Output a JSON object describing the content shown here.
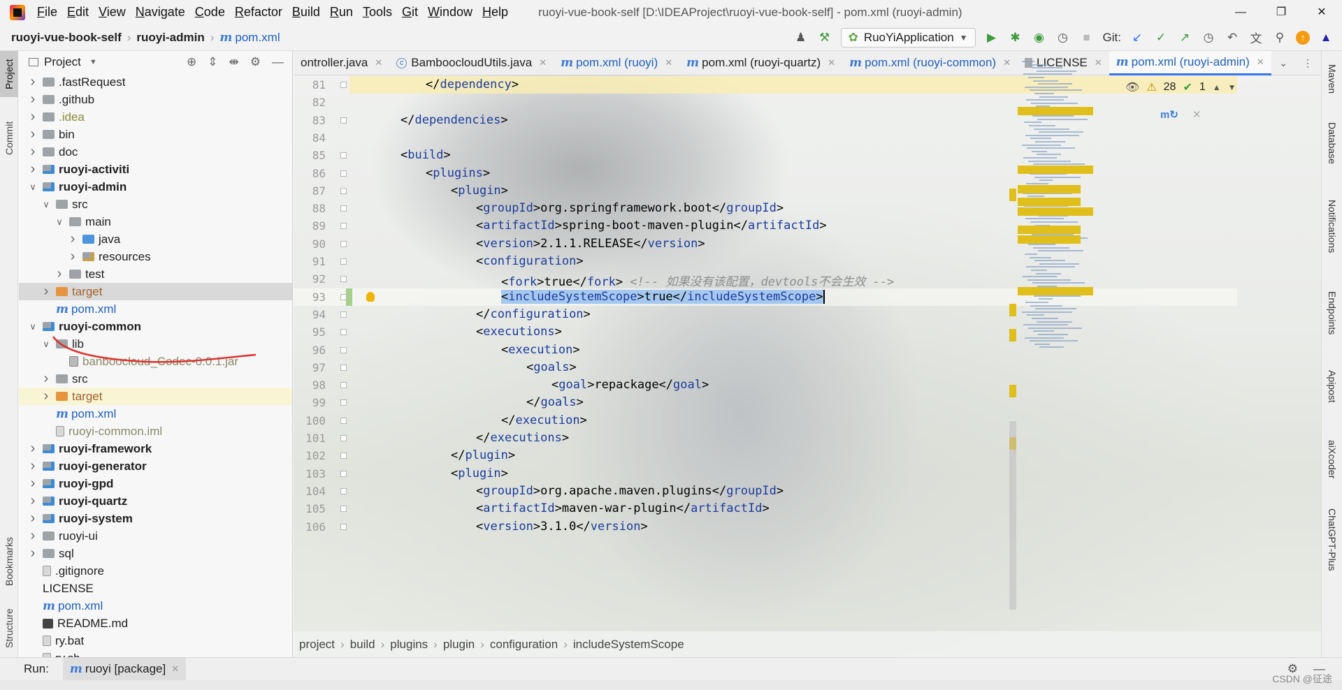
{
  "titlebar": {
    "menu": [
      "File",
      "Edit",
      "View",
      "Navigate",
      "Code",
      "Refactor",
      "Build",
      "Run",
      "Tools",
      "Git",
      "Window",
      "Help"
    ],
    "title": "ruoyi-vue-book-self [D:\\IDEAProject\\ruoyi-vue-book-self] - pom.xml (ruoyi-admin)"
  },
  "navbar": {
    "project": "ruoyi-vue-book-self",
    "module": "ruoyi-admin",
    "file": "pom.xml",
    "run_config": "RuoYiApplication",
    "git_label": "Git:"
  },
  "left_strip": {
    "tabs": [
      "Project",
      "Commit",
      "Bookmarks",
      "Structure"
    ]
  },
  "right_strip": {
    "tabs": [
      "Maven",
      "Database",
      "Notifications",
      "Endpoints",
      "Apipost",
      "aiXcoder",
      "ChatGPT-Plus"
    ]
  },
  "project_panel": {
    "title": "Project",
    "tree": [
      {
        "label": ".fastRequest",
        "depth": 1,
        "chev": "right",
        "icon": "folder",
        "style": ""
      },
      {
        "label": ".github",
        "depth": 1,
        "chev": "right",
        "icon": "folder",
        "style": ""
      },
      {
        "label": ".idea",
        "depth": 1,
        "chev": "right",
        "icon": "folder",
        "style": "muted"
      },
      {
        "label": "bin",
        "depth": 1,
        "chev": "right",
        "icon": "folder",
        "style": ""
      },
      {
        "label": "doc",
        "depth": 1,
        "chev": "right",
        "icon": "folder",
        "style": ""
      },
      {
        "label": "ruoyi-activiti",
        "depth": 1,
        "chev": "right",
        "icon": "module",
        "style": "bold"
      },
      {
        "label": "ruoyi-admin",
        "depth": 1,
        "chev": "down",
        "icon": "module",
        "style": "bold"
      },
      {
        "label": "src",
        "depth": 2,
        "chev": "down",
        "icon": "folder",
        "style": ""
      },
      {
        "label": "main",
        "depth": 3,
        "chev": "down",
        "icon": "folder",
        "style": ""
      },
      {
        "label": "java",
        "depth": 4,
        "chev": "right",
        "icon": "blue",
        "style": ""
      },
      {
        "label": "resources",
        "depth": 4,
        "chev": "right",
        "icon": "res",
        "style": ""
      },
      {
        "label": "test",
        "depth": 3,
        "chev": "right",
        "icon": "folder",
        "style": ""
      },
      {
        "label": "target",
        "depth": 2,
        "chev": "right",
        "icon": "orange",
        "style": "orange",
        "row": "sel"
      },
      {
        "label": "pom.xml",
        "depth": 2,
        "chev": "none",
        "icon": "m",
        "style": "link"
      },
      {
        "label": "ruoyi-common",
        "depth": 1,
        "chev": "down",
        "icon": "module",
        "style": "bold"
      },
      {
        "label": "lib",
        "depth": 2,
        "chev": "down",
        "icon": "folder",
        "style": ""
      },
      {
        "label": "banboocloud_Codec-0.0.1.jar",
        "depth": 3,
        "chev": "none",
        "icon": "jar",
        "style": "jar"
      },
      {
        "label": "src",
        "depth": 2,
        "chev": "right",
        "icon": "folder",
        "style": ""
      },
      {
        "label": "target",
        "depth": 2,
        "chev": "right",
        "icon": "orange",
        "style": "orange",
        "row": "hl"
      },
      {
        "label": "pom.xml",
        "depth": 2,
        "chev": "none",
        "icon": "m",
        "style": "link"
      },
      {
        "label": "ruoyi-common.iml",
        "depth": 2,
        "chev": "none",
        "icon": "file",
        "style": "jar"
      },
      {
        "label": "ruoyi-framework",
        "depth": 1,
        "chev": "right",
        "icon": "module",
        "style": "bold"
      },
      {
        "label": "ruoyi-generator",
        "depth": 1,
        "chev": "right",
        "icon": "module",
        "style": "bold"
      },
      {
        "label": "ruoyi-gpd",
        "depth": 1,
        "chev": "right",
        "icon": "module",
        "style": "bold"
      },
      {
        "label": "ruoyi-quartz",
        "depth": 1,
        "chev": "right",
        "icon": "module",
        "style": "bold"
      },
      {
        "label": "ruoyi-system",
        "depth": 1,
        "chev": "right",
        "icon": "module",
        "style": "bold"
      },
      {
        "label": "ruoyi-ui",
        "depth": 1,
        "chev": "right",
        "icon": "folder",
        "style": ""
      },
      {
        "label": "sql",
        "depth": 1,
        "chev": "right",
        "icon": "folder",
        "style": ""
      },
      {
        "label": ".gitignore",
        "depth": 1,
        "chev": "none",
        "icon": "file",
        "style": ""
      },
      {
        "label": "LICENSE",
        "depth": 1,
        "chev": "none",
        "icon": "none",
        "style": ""
      },
      {
        "label": "pom.xml",
        "depth": 1,
        "chev": "none",
        "icon": "m",
        "style": "link"
      },
      {
        "label": "README.md",
        "depth": 1,
        "chev": "none",
        "icon": "md",
        "style": ""
      },
      {
        "label": "ry.bat",
        "depth": 1,
        "chev": "none",
        "icon": "file",
        "style": ""
      },
      {
        "label": "ry.sh",
        "depth": 1,
        "chev": "none",
        "icon": "file",
        "style": ""
      }
    ]
  },
  "editor": {
    "tabs": [
      {
        "label": "ontroller.java",
        "kind": "plain",
        "active": false,
        "close": true
      },
      {
        "label": "BamboocloudUtils.java",
        "kind": "class",
        "active": false,
        "close": true
      },
      {
        "label": "pom.xml (ruoyi)",
        "kind": "pom",
        "active": false,
        "close": true
      },
      {
        "label": "pom.xml (ruoyi-quartz)",
        "kind": "pom-dark",
        "active": false,
        "close": true
      },
      {
        "label": "pom.xml (ruoyi-common)",
        "kind": "pom",
        "active": false,
        "close": true
      },
      {
        "label": "LICENSE",
        "kind": "license",
        "active": false,
        "close": true
      },
      {
        "label": "pom.xml (ruoyi-admin)",
        "kind": "pom",
        "active": true,
        "close": true
      }
    ],
    "inspections": {
      "warnings": "28",
      "ok": "1"
    },
    "lines": [
      {
        "n": "81",
        "indent": 2,
        "parts": [
          [
            "br",
            "</"
          ],
          [
            "tag",
            "dependency"
          ],
          [
            "br",
            ">"
          ]
        ],
        "bg": "yellow"
      },
      {
        "n": "82",
        "indent": 0,
        "parts": []
      },
      {
        "n": "83",
        "indent": 1,
        "parts": [
          [
            "br",
            "</"
          ],
          [
            "tag",
            "dependencies"
          ],
          [
            "br",
            ">"
          ]
        ]
      },
      {
        "n": "84",
        "indent": 0,
        "parts": []
      },
      {
        "n": "85",
        "indent": 1,
        "parts": [
          [
            "br",
            "<"
          ],
          [
            "tag",
            "build"
          ],
          [
            "br",
            ">"
          ]
        ]
      },
      {
        "n": "86",
        "indent": 2,
        "parts": [
          [
            "br",
            "<"
          ],
          [
            "tag",
            "plugins"
          ],
          [
            "br",
            ">"
          ]
        ]
      },
      {
        "n": "87",
        "indent": 3,
        "parts": [
          [
            "br",
            "<"
          ],
          [
            "tag",
            "plugin"
          ],
          [
            "br",
            ">"
          ]
        ]
      },
      {
        "n": "88",
        "indent": 4,
        "parts": [
          [
            "br",
            "<"
          ],
          [
            "tag",
            "groupId"
          ],
          [
            "br",
            ">org.springframework.boot</"
          ],
          [
            "tag",
            "groupId"
          ],
          [
            "br",
            ">"
          ]
        ]
      },
      {
        "n": "89",
        "indent": 4,
        "parts": [
          [
            "br",
            "<"
          ],
          [
            "tag",
            "artifactId"
          ],
          [
            "br",
            ">spring-boot-maven-plugin</"
          ],
          [
            "tag",
            "artifactId"
          ],
          [
            "br",
            ">"
          ]
        ]
      },
      {
        "n": "90",
        "indent": 4,
        "parts": [
          [
            "br",
            "<"
          ],
          [
            "tag",
            "version"
          ],
          [
            "br",
            ">2.1.1.RELEASE</"
          ],
          [
            "tag",
            "version"
          ],
          [
            "br",
            ">"
          ]
        ]
      },
      {
        "n": "91",
        "indent": 4,
        "parts": [
          [
            "br",
            "<"
          ],
          [
            "tag",
            "configuration"
          ],
          [
            "br",
            ">"
          ]
        ]
      },
      {
        "n": "92",
        "indent": 5,
        "parts": [
          [
            "br",
            "<"
          ],
          [
            "tag",
            "fork"
          ],
          [
            "br",
            ">true</"
          ],
          [
            "tag",
            "fork"
          ],
          [
            "br",
            "> "
          ],
          [
            "cmt",
            "<!-- 如果没有该配置，devtools不会生效 -->"
          ]
        ]
      },
      {
        "n": "93",
        "indent": 5,
        "parts": [
          [
            "br",
            "<"
          ],
          [
            "tag",
            "includeSystemScope"
          ],
          [
            "br",
            ">true</"
          ],
          [
            "tag",
            "includeSystemScope"
          ],
          [
            "br",
            ">"
          ]
        ],
        "bg": "current",
        "selected": true
      },
      {
        "n": "94",
        "indent": 4,
        "parts": [
          [
            "br",
            "</"
          ],
          [
            "tag",
            "configuration"
          ],
          [
            "br",
            ">"
          ]
        ]
      },
      {
        "n": "95",
        "indent": 4,
        "parts": [
          [
            "br",
            "<"
          ],
          [
            "tag",
            "executions"
          ],
          [
            "br",
            ">"
          ]
        ]
      },
      {
        "n": "96",
        "indent": 5,
        "parts": [
          [
            "br",
            "<"
          ],
          [
            "tag",
            "execution"
          ],
          [
            "br",
            ">"
          ]
        ]
      },
      {
        "n": "97",
        "indent": 6,
        "parts": [
          [
            "br",
            "<"
          ],
          [
            "tag",
            "goals"
          ],
          [
            "br",
            ">"
          ]
        ]
      },
      {
        "n": "98",
        "indent": 7,
        "parts": [
          [
            "br",
            "<"
          ],
          [
            "tag",
            "goal"
          ],
          [
            "br",
            ">repackage</"
          ],
          [
            "tag",
            "goal"
          ],
          [
            "br",
            ">"
          ]
        ]
      },
      {
        "n": "99",
        "indent": 6,
        "parts": [
          [
            "br",
            "</"
          ],
          [
            "tag",
            "goals"
          ],
          [
            "br",
            ">"
          ]
        ]
      },
      {
        "n": "100",
        "indent": 5,
        "parts": [
          [
            "br",
            "</"
          ],
          [
            "tag",
            "execution"
          ],
          [
            "br",
            ">"
          ]
        ]
      },
      {
        "n": "101",
        "indent": 4,
        "parts": [
          [
            "br",
            "</"
          ],
          [
            "tag",
            "executions"
          ],
          [
            "br",
            ">"
          ]
        ]
      },
      {
        "n": "102",
        "indent": 3,
        "parts": [
          [
            "br",
            "</"
          ],
          [
            "tag",
            "plugin"
          ],
          [
            "br",
            ">"
          ]
        ]
      },
      {
        "n": "103",
        "indent": 3,
        "parts": [
          [
            "br",
            "<"
          ],
          [
            "tag",
            "plugin"
          ],
          [
            "br",
            ">"
          ]
        ]
      },
      {
        "n": "104",
        "indent": 4,
        "parts": [
          [
            "br",
            "<"
          ],
          [
            "tag",
            "groupId"
          ],
          [
            "br",
            ">org.apache.maven.plugins</"
          ],
          [
            "tag",
            "groupId"
          ],
          [
            "br",
            ">"
          ]
        ]
      },
      {
        "n": "105",
        "indent": 4,
        "parts": [
          [
            "br",
            "<"
          ],
          [
            "tag",
            "artifactId"
          ],
          [
            "br",
            ">maven-war-plugin</"
          ],
          [
            "tag",
            "artifactId"
          ],
          [
            "br",
            ">"
          ]
        ]
      },
      {
        "n": "106",
        "indent": 4,
        "parts": [
          [
            "br",
            "<"
          ],
          [
            "tag",
            "version"
          ],
          [
            "br",
            ">3.1.0</"
          ],
          [
            "tag",
            "version"
          ],
          [
            "br",
            ">"
          ]
        ]
      }
    ],
    "breadcrumb": [
      "project",
      "build",
      "plugins",
      "plugin",
      "configuration",
      "includeSystemScope"
    ]
  },
  "runbar": {
    "label": "Run:",
    "tab": "ruoyi [package]"
  },
  "watermark": "CSDN @征途",
  "colors": {
    "accent": "#3574f0",
    "tag": "#1a3b9c",
    "selection": "#a5c8f0",
    "annotation": "#e0302a"
  }
}
